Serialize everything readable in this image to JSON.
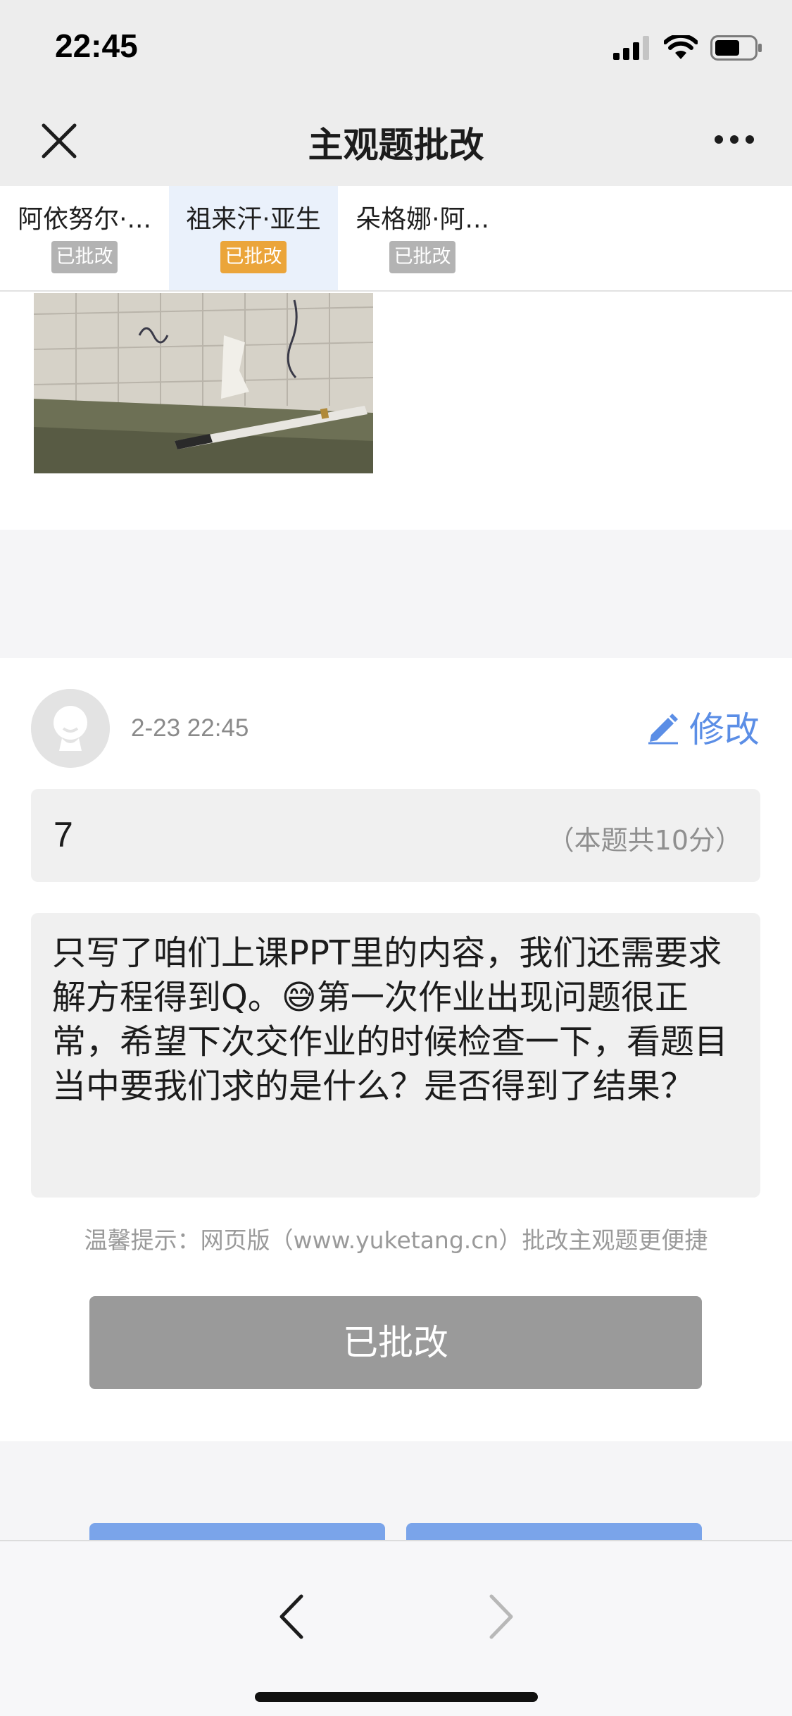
{
  "status_bar": {
    "time": "22:45"
  },
  "nav": {
    "title": "主观题批改"
  },
  "students": [
    {
      "name": "阿依努尔·...",
      "status": "已批改",
      "active": false
    },
    {
      "name": "祖来汗·亚生",
      "status": "已批改",
      "active": true
    },
    {
      "name": "朵格娜·阿...",
      "status": "已批改",
      "active": false
    }
  ],
  "grading": {
    "time": "2-23 22:45",
    "edit_label": "修改",
    "score": "7",
    "score_total": "（本题共10分）",
    "comment": "只写了咱们上课PPT里的内容，我们还需要求解方程得到Q。😅第一次作业出现问题很正常，希望下次交作业的时候检查一下，看题目当中要我们求的是什么？是否得到了结果？",
    "tip": "温馨提示：网页版（www.yuketang.cn）批改主观题更便捷",
    "graded_button": "已批改"
  },
  "colors": {
    "accent": "#5b8ee6",
    "badge_active": "#eba53a",
    "badge_inactive": "#b3b3b3",
    "graded_button": "#9a9a9a"
  },
  "icons": {
    "close": "close-icon",
    "more": "more-icon",
    "edit": "pencil-icon",
    "prev": "chevron-left-icon",
    "next": "chevron-right-icon"
  }
}
